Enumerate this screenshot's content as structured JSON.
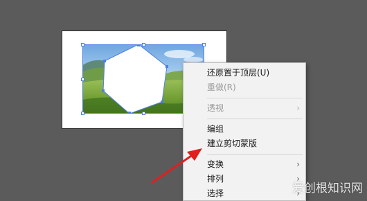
{
  "context_menu": {
    "items": [
      {
        "label": "还原置于顶层(U)",
        "enabled": true,
        "submenu": false
      },
      {
        "label": "重做(R)",
        "enabled": false,
        "submenu": false
      },
      {
        "label": "透视",
        "enabled": false,
        "submenu": true
      },
      {
        "label": "编组",
        "enabled": true,
        "submenu": false
      },
      {
        "label": "建立剪切蒙版",
        "enabled": true,
        "submenu": false
      },
      {
        "label": "变换",
        "enabled": true,
        "submenu": true
      },
      {
        "label": "排列",
        "enabled": true,
        "submenu": true
      },
      {
        "label": "选择",
        "enabled": true,
        "submenu": true
      }
    ],
    "submenu_glyph": "›"
  },
  "watermark": {
    "text": "爱创根知识网"
  },
  "colors": {
    "workspace_bg": "#5b5b5b",
    "selection": "#4d7fe0",
    "annotation_arrow": "#e01f1f",
    "menu_bg": "#f2f2f2"
  },
  "icons": {
    "arrow": "red-pointer-arrow",
    "submenu": "chevron-right-icon"
  }
}
